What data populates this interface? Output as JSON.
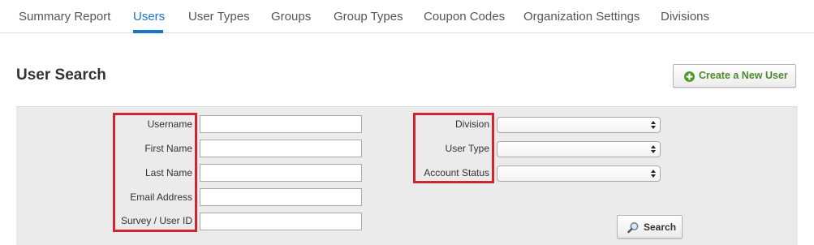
{
  "nav": {
    "tabs": [
      {
        "label": "Summary Report",
        "active": false
      },
      {
        "label": "Users",
        "active": true
      },
      {
        "label": "User Types",
        "active": false
      },
      {
        "label": "Groups",
        "active": false
      },
      {
        "label": "Group Types",
        "active": false
      },
      {
        "label": "Coupon Codes",
        "active": false
      },
      {
        "label": "Organization Settings",
        "active": false
      },
      {
        "label": "Divisions",
        "active": false
      }
    ]
  },
  "header": {
    "title": "User Search",
    "create_button_label": "Create a New User"
  },
  "search_form": {
    "text_fields": [
      {
        "label": "Username",
        "value": ""
      },
      {
        "label": "First Name",
        "value": ""
      },
      {
        "label": "Last Name",
        "value": ""
      },
      {
        "label": "Email Address",
        "value": ""
      },
      {
        "label": "Survey / User ID",
        "value": ""
      }
    ],
    "select_fields": [
      {
        "label": "Division",
        "value": ""
      },
      {
        "label": "User Type",
        "value": ""
      },
      {
        "label": "Account Status",
        "value": ""
      }
    ],
    "search_button_label": "Search"
  },
  "colors": {
    "accent": "#1a73c8",
    "highlight_box": "#d0262f",
    "create_green": "#4c8a2e",
    "panel_bg": "#ebebeb"
  },
  "icons": [
    "plus-circle-icon",
    "select-caret-icon",
    "magnifier-icon"
  ]
}
